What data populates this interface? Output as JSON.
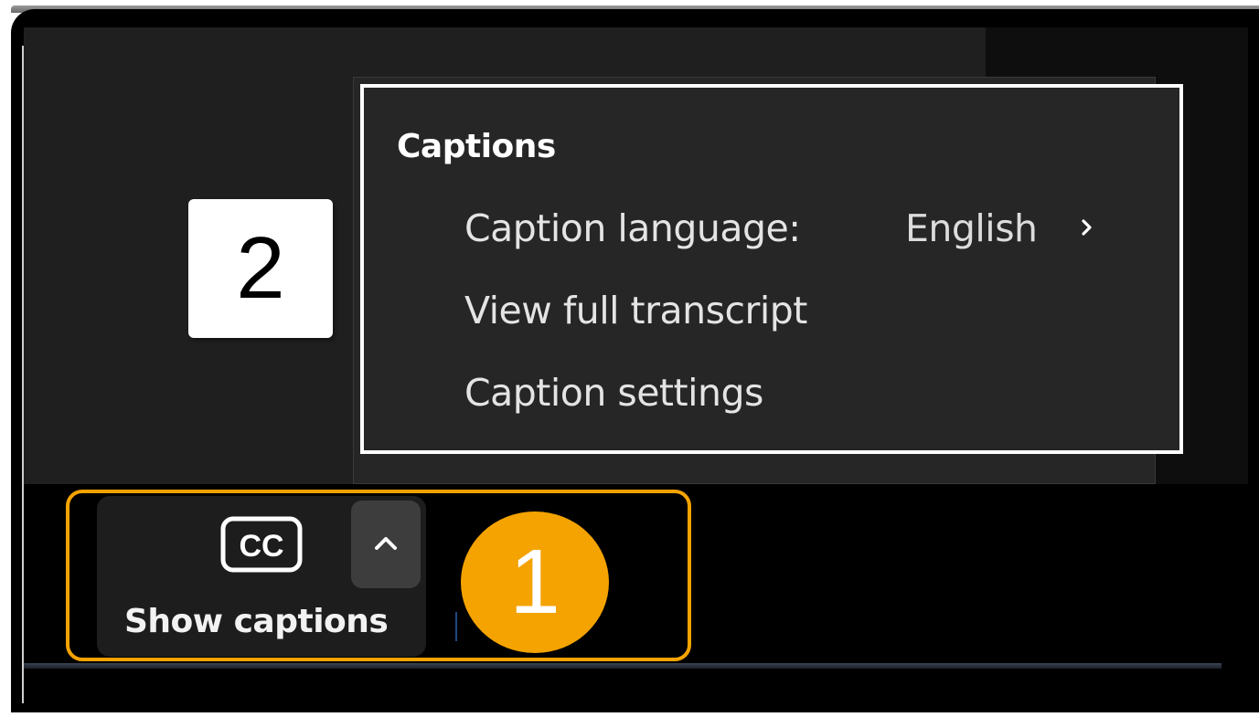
{
  "captions_menu": {
    "heading": "Captions",
    "items": [
      {
        "label": "Caption language:",
        "value": "English"
      },
      {
        "label": "View full transcript"
      },
      {
        "label": "Caption settings"
      }
    ]
  },
  "toolbar": {
    "captions_button": {
      "icon_text": "CC",
      "label": "Show captions"
    }
  },
  "callouts": {
    "one": "1",
    "two": "2"
  },
  "colors": {
    "callout_one": "#f4a300",
    "menu_background": "#262626",
    "highlight_border": "#ffffff"
  },
  "icons": {
    "cc": "closed-captions-icon",
    "chevron_up": "chevron-up-icon",
    "chevron_right": "chevron-right-icon"
  }
}
